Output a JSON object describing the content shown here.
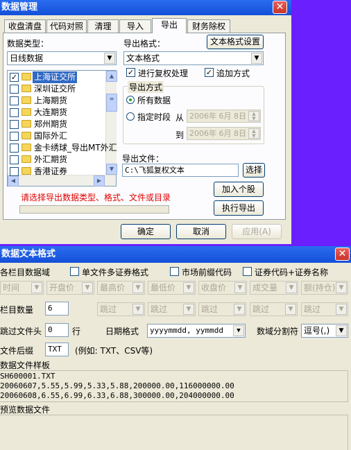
{
  "top_dialog": {
    "title": "数据管理",
    "close_glyph": "✕",
    "tabs": [
      "收盘清盘",
      "代码对照",
      "清理",
      "导入",
      "导出",
      "财务除权"
    ],
    "data_type_label": "数据类型：",
    "data_type_value": "日线数据",
    "market_list": [
      "上海证交所",
      "深圳证交所",
      "上海期货",
      "大连期货",
      "郑州期货",
      "国际外汇",
      "金卡绣球_导出MT外汇",
      "外汇期货",
      "香港证券"
    ],
    "market_checked": [
      true,
      false,
      false,
      false,
      false,
      false,
      false,
      false,
      false
    ],
    "export_format_label": "导出格式：",
    "text_format_button": "文本格式设置",
    "export_format_value": "文本格式",
    "restore_rights_label": "进行复权处理",
    "restore_rights_checked": true,
    "append_label": "追加方式",
    "append_checked": true,
    "export_mode_group": "导出方式",
    "all_data_label": "所有数据",
    "period_label": "指定时段",
    "from_label": "从",
    "from_date": "2006年 6月 8日",
    "to_label": "到",
    "to_date": "2006年 6月 8日",
    "export_file_label": "导出文件：",
    "export_file_value": "C:\\飞狐复权文本",
    "choose_button": "选择",
    "status_text": "请选择导出数据类型、格式、文件或目录",
    "add_stock_button": "加入个股",
    "execute_button": "执行导出",
    "ok_button": "确定",
    "cancel_button": "取消",
    "apply_button": "应用(A)"
  },
  "text_format_dialog": {
    "title": "数据文本格式",
    "close_glyph": "✕",
    "columns_label": "各栏目数据域",
    "single_file_label": "单文件多证券格式",
    "market_prefix_label": "市场前缀代码",
    "code_name_label": "证券代码+证券名称",
    "field_combos": [
      "时间",
      "开盘价",
      "最高价",
      "最低价",
      "收盘价",
      "成交量",
      "额(持仓)"
    ],
    "column_count_label": "栏目数量",
    "column_count_value": "6",
    "skip_combos": [
      "跳过",
      "跳过",
      "跳过",
      "跳过",
      "跳过",
      "跳过"
    ],
    "skip_header_label": "跳过文件头",
    "skip_header_value": "0",
    "row_unit": "行",
    "date_format_label": "日期格式",
    "date_format_value": "yyyymmdd, yymmdd",
    "separator_label": "数域分割符",
    "separator_value": "逗号(,)",
    "suffix_label": "文件后缀",
    "suffix_value": "TXT",
    "suffix_example": "(例如: TXT、CSV等)",
    "sample_label": "数据文件样板",
    "sample_lines": [
      "SH600001.TXT",
      "20060607,5.55,5.99,5.33,5.88,200000.00,116000000.00",
      "20060608,6.55,6.99,6.33,6.88,300000.00,204000000.00"
    ],
    "preview_label": "预览数据文件"
  },
  "colors": {
    "title_bar": "#1450d8",
    "background": "#6a1fff",
    "face": "#ece9d8",
    "status_text": "#e00000"
  }
}
